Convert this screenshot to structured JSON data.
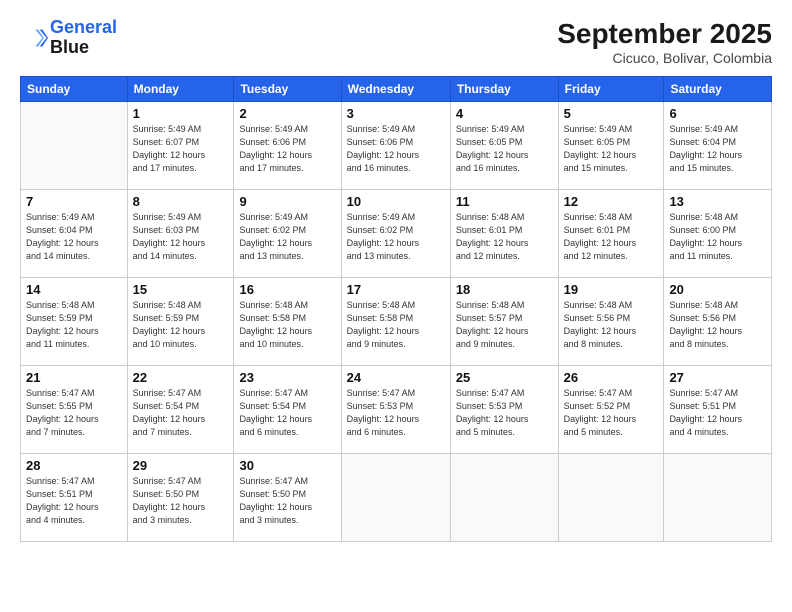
{
  "header": {
    "logo_line1": "General",
    "logo_line2": "Blue",
    "month": "September 2025",
    "location": "Cicuco, Bolivar, Colombia"
  },
  "days_of_week": [
    "Sunday",
    "Monday",
    "Tuesday",
    "Wednesday",
    "Thursday",
    "Friday",
    "Saturday"
  ],
  "weeks": [
    [
      {
        "day": "",
        "info": ""
      },
      {
        "day": "1",
        "info": "Sunrise: 5:49 AM\nSunset: 6:07 PM\nDaylight: 12 hours\nand 17 minutes."
      },
      {
        "day": "2",
        "info": "Sunrise: 5:49 AM\nSunset: 6:06 PM\nDaylight: 12 hours\nand 17 minutes."
      },
      {
        "day": "3",
        "info": "Sunrise: 5:49 AM\nSunset: 6:06 PM\nDaylight: 12 hours\nand 16 minutes."
      },
      {
        "day": "4",
        "info": "Sunrise: 5:49 AM\nSunset: 6:05 PM\nDaylight: 12 hours\nand 16 minutes."
      },
      {
        "day": "5",
        "info": "Sunrise: 5:49 AM\nSunset: 6:05 PM\nDaylight: 12 hours\nand 15 minutes."
      },
      {
        "day": "6",
        "info": "Sunrise: 5:49 AM\nSunset: 6:04 PM\nDaylight: 12 hours\nand 15 minutes."
      }
    ],
    [
      {
        "day": "7",
        "info": "Sunrise: 5:49 AM\nSunset: 6:04 PM\nDaylight: 12 hours\nand 14 minutes."
      },
      {
        "day": "8",
        "info": "Sunrise: 5:49 AM\nSunset: 6:03 PM\nDaylight: 12 hours\nand 14 minutes."
      },
      {
        "day": "9",
        "info": "Sunrise: 5:49 AM\nSunset: 6:02 PM\nDaylight: 12 hours\nand 13 minutes."
      },
      {
        "day": "10",
        "info": "Sunrise: 5:49 AM\nSunset: 6:02 PM\nDaylight: 12 hours\nand 13 minutes."
      },
      {
        "day": "11",
        "info": "Sunrise: 5:48 AM\nSunset: 6:01 PM\nDaylight: 12 hours\nand 12 minutes."
      },
      {
        "day": "12",
        "info": "Sunrise: 5:48 AM\nSunset: 6:01 PM\nDaylight: 12 hours\nand 12 minutes."
      },
      {
        "day": "13",
        "info": "Sunrise: 5:48 AM\nSunset: 6:00 PM\nDaylight: 12 hours\nand 11 minutes."
      }
    ],
    [
      {
        "day": "14",
        "info": "Sunrise: 5:48 AM\nSunset: 5:59 PM\nDaylight: 12 hours\nand 11 minutes."
      },
      {
        "day": "15",
        "info": "Sunrise: 5:48 AM\nSunset: 5:59 PM\nDaylight: 12 hours\nand 10 minutes."
      },
      {
        "day": "16",
        "info": "Sunrise: 5:48 AM\nSunset: 5:58 PM\nDaylight: 12 hours\nand 10 minutes."
      },
      {
        "day": "17",
        "info": "Sunrise: 5:48 AM\nSunset: 5:58 PM\nDaylight: 12 hours\nand 9 minutes."
      },
      {
        "day": "18",
        "info": "Sunrise: 5:48 AM\nSunset: 5:57 PM\nDaylight: 12 hours\nand 9 minutes."
      },
      {
        "day": "19",
        "info": "Sunrise: 5:48 AM\nSunset: 5:56 PM\nDaylight: 12 hours\nand 8 minutes."
      },
      {
        "day": "20",
        "info": "Sunrise: 5:48 AM\nSunset: 5:56 PM\nDaylight: 12 hours\nand 8 minutes."
      }
    ],
    [
      {
        "day": "21",
        "info": "Sunrise: 5:47 AM\nSunset: 5:55 PM\nDaylight: 12 hours\nand 7 minutes."
      },
      {
        "day": "22",
        "info": "Sunrise: 5:47 AM\nSunset: 5:54 PM\nDaylight: 12 hours\nand 7 minutes."
      },
      {
        "day": "23",
        "info": "Sunrise: 5:47 AM\nSunset: 5:54 PM\nDaylight: 12 hours\nand 6 minutes."
      },
      {
        "day": "24",
        "info": "Sunrise: 5:47 AM\nSunset: 5:53 PM\nDaylight: 12 hours\nand 6 minutes."
      },
      {
        "day": "25",
        "info": "Sunrise: 5:47 AM\nSunset: 5:53 PM\nDaylight: 12 hours\nand 5 minutes."
      },
      {
        "day": "26",
        "info": "Sunrise: 5:47 AM\nSunset: 5:52 PM\nDaylight: 12 hours\nand 5 minutes."
      },
      {
        "day": "27",
        "info": "Sunrise: 5:47 AM\nSunset: 5:51 PM\nDaylight: 12 hours\nand 4 minutes."
      }
    ],
    [
      {
        "day": "28",
        "info": "Sunrise: 5:47 AM\nSunset: 5:51 PM\nDaylight: 12 hours\nand 4 minutes."
      },
      {
        "day": "29",
        "info": "Sunrise: 5:47 AM\nSunset: 5:50 PM\nDaylight: 12 hours\nand 3 minutes."
      },
      {
        "day": "30",
        "info": "Sunrise: 5:47 AM\nSunset: 5:50 PM\nDaylight: 12 hours\nand 3 minutes."
      },
      {
        "day": "",
        "info": ""
      },
      {
        "day": "",
        "info": ""
      },
      {
        "day": "",
        "info": ""
      },
      {
        "day": "",
        "info": ""
      }
    ]
  ]
}
